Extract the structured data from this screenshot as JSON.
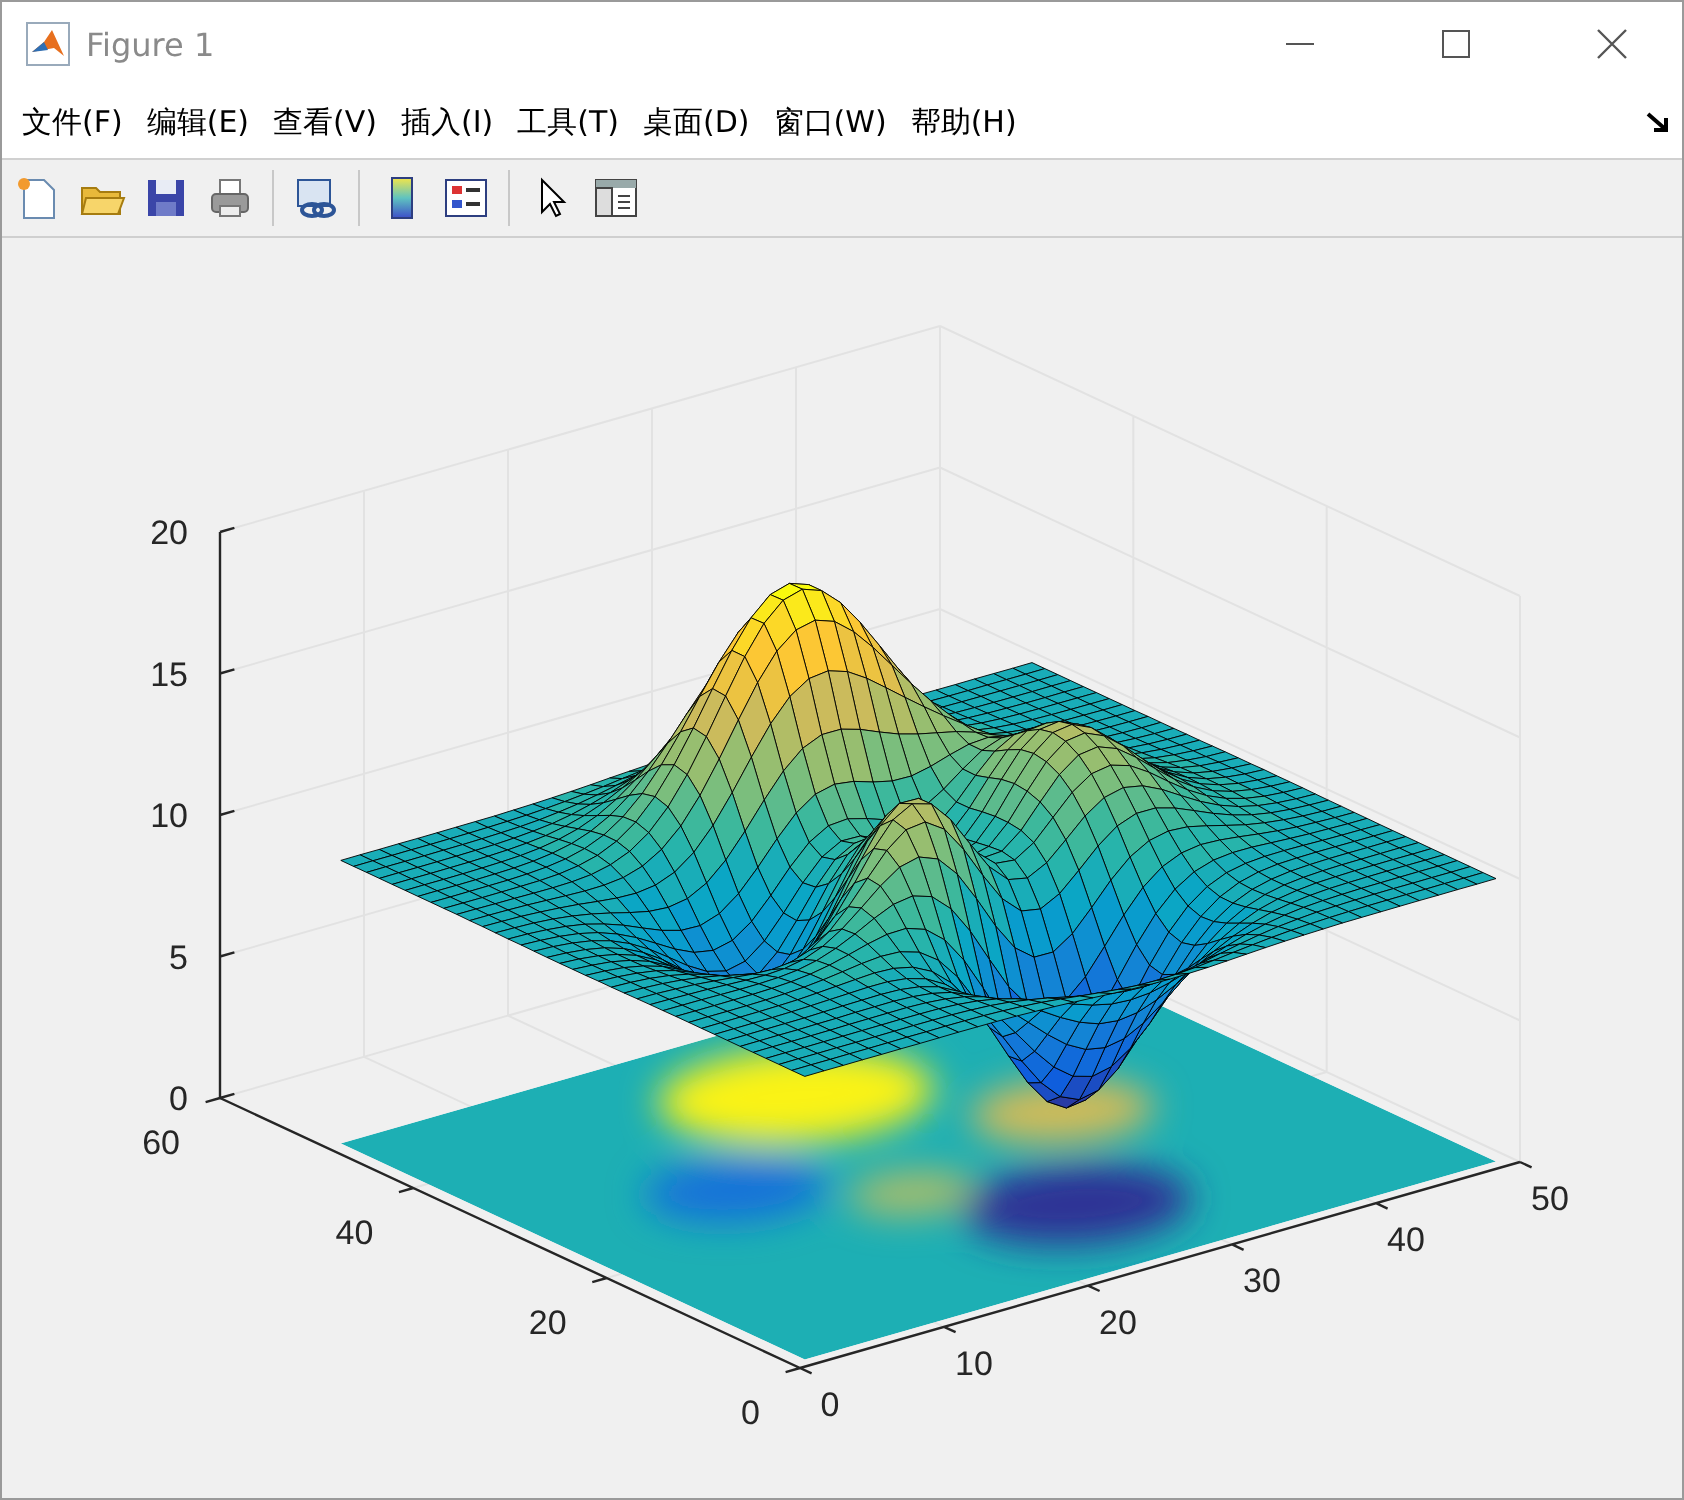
{
  "window": {
    "title": "Figure 1"
  },
  "menu": [
    "文件(F)",
    "编辑(E)",
    "查看(V)",
    "插入(I)",
    "工具(T)",
    "桌面(D)",
    "窗口(W)",
    "帮助(H)"
  ],
  "axes": {
    "x_ticks": [
      "0",
      "10",
      "20",
      "30",
      "40",
      "50"
    ],
    "y_ticks": [
      "60",
      "40",
      "20",
      "0"
    ],
    "z_ticks": [
      "20",
      "15",
      "10",
      "5",
      "0"
    ]
  }
}
